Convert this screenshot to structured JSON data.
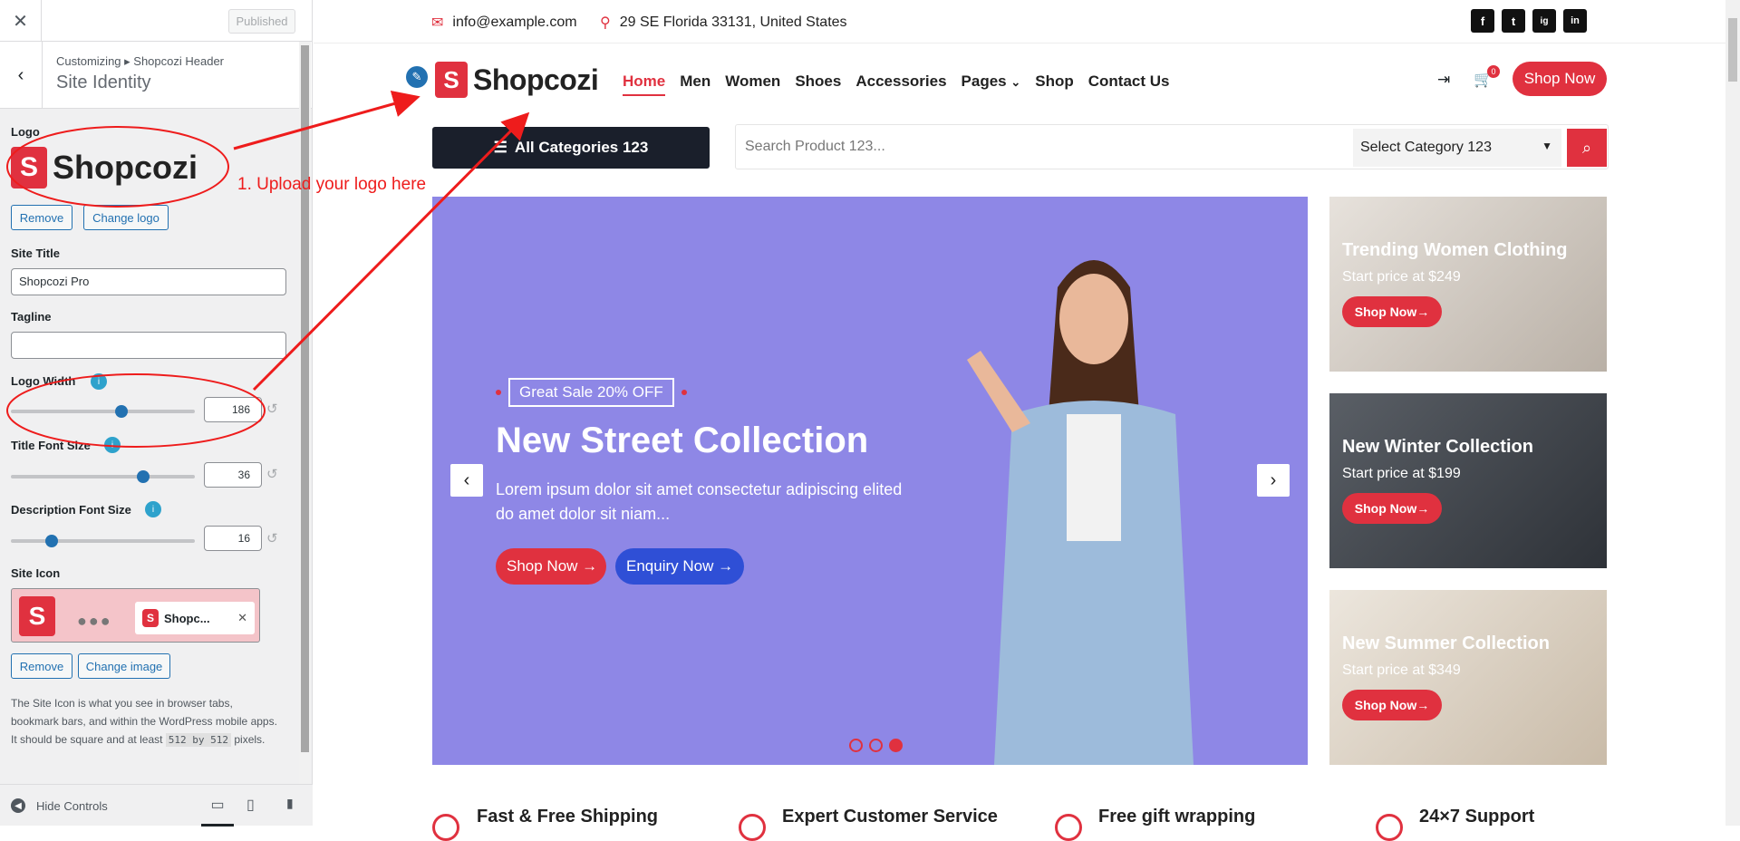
{
  "sidebar": {
    "published": "Published",
    "breadcrumb": "Customizing ▸ Shopcozi Header",
    "section_title": "Site Identity",
    "logo_label": "Logo",
    "logo_text": "Shopcozi",
    "remove": "Remove",
    "change_logo": "Change logo",
    "site_title_label": "Site Title",
    "site_title_value": "Shopcozi Pro",
    "tagline_label": "Tagline",
    "tagline_value": "",
    "logo_width_label": "Logo Width",
    "logo_width_value": "186",
    "logo_width_level": 0.6,
    "title_font_label": "Title Font Size",
    "title_font_value": "36",
    "title_font_level": 0.72,
    "desc_font_label": "Description Font Size",
    "desc_font_value": "16",
    "desc_font_level": 0.22,
    "site_icon_label": "Site Icon",
    "site_icon_tab": "Shopc...",
    "change_image": "Change image",
    "icon_desc": "The Site Icon is what you see in browser tabs, bookmark bars, and within the WordPress mobile apps. It should be square and at least",
    "icon_desc_size": "512 by 512",
    "icon_desc_end": "pixels.",
    "hide_controls": "Hide Controls"
  },
  "annotation": {
    "text": "1. Upload your logo here",
    "color": "#ee1c1c"
  },
  "site": {
    "email": "info@example.com",
    "address": "29 SE Florida 33131, United States",
    "social": [
      "f",
      "t",
      "ig",
      "in"
    ],
    "logo": "Shopcozi",
    "nav": [
      "Home",
      "Men",
      "Women",
      "Shoes",
      "Accessories",
      "Pages",
      "Shop",
      "Contact Us"
    ],
    "cart_count": "0",
    "shop_now": "Shop Now",
    "all_categories": "All Categories 123",
    "search_placeholder": "Search Product 123...",
    "select_category": "Select Category 123",
    "accent": "#e0313f"
  },
  "hero": {
    "badge": "Great Sale 20% OFF",
    "title": "New Street Collection",
    "text": "Lorem ipsum dolor sit amet consectetur adipiscing elited do amet dolor sit niam...",
    "btn1": "Shop Now →",
    "btn2": "Enquiry Now →",
    "bg": "#8e87e6"
  },
  "side_banners": [
    {
      "title": "Trending Women Clothing",
      "sub": "Start price at $249",
      "btn": "Shop Now→"
    },
    {
      "title": "New Winter Collection",
      "sub": "Start price at $199",
      "btn": "Shop Now→"
    },
    {
      "title": "New Summer Collection",
      "sub": "Start price at $349",
      "btn": "Shop Now→"
    }
  ],
  "features": [
    "Fast & Free Shipping",
    "Expert Customer Service",
    "Free gift wrapping",
    "24×7 Support"
  ]
}
